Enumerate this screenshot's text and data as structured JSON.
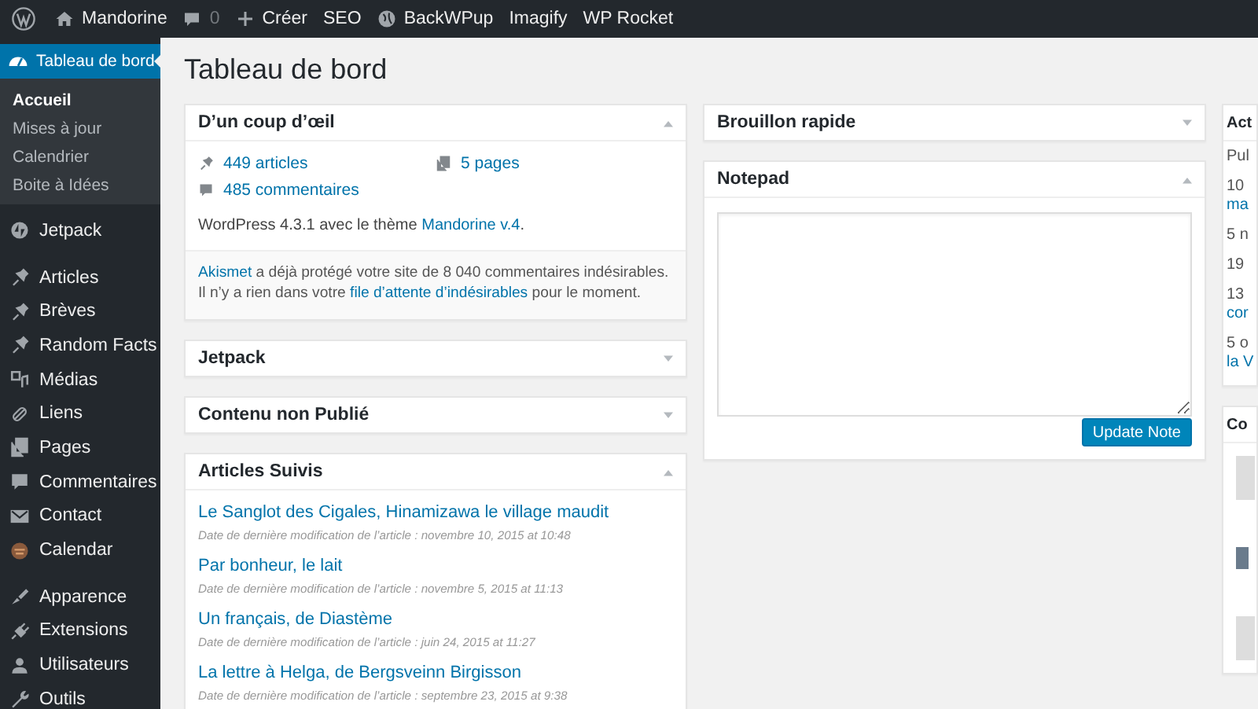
{
  "admin_bar": {
    "site": "Mandorine",
    "comments": "0",
    "items": [
      {
        "label": "Créer"
      },
      {
        "label": "SEO"
      },
      {
        "label": "BackWPup"
      },
      {
        "label": "Imagify"
      },
      {
        "label": "WP Rocket"
      }
    ]
  },
  "sidebar": {
    "current": {
      "label": "Tableau de bord",
      "selected": true,
      "children": [
        {
          "label": "Accueil",
          "selected": true
        },
        {
          "label": "Mises à jour",
          "selected": false
        },
        {
          "label": "Calendrier",
          "selected": false
        },
        {
          "label": "Boite à Idées",
          "selected": false
        }
      ]
    },
    "groups": [
      {
        "items": [
          {
            "label": "Jetpack"
          }
        ]
      },
      {
        "items": [
          {
            "label": "Articles"
          },
          {
            "label": "Brèves"
          },
          {
            "label": "Random Facts"
          },
          {
            "label": "Médias"
          },
          {
            "label": "Liens"
          },
          {
            "label": "Pages"
          },
          {
            "label": "Commentaires"
          },
          {
            "label": "Contact"
          },
          {
            "label": "Calendar"
          }
        ]
      },
      {
        "items": [
          {
            "label": "Apparence"
          },
          {
            "label": "Extensions"
          },
          {
            "label": "Utilisateurs"
          },
          {
            "label": "Outils"
          }
        ]
      }
    ]
  },
  "page_title": "Tableau de bord",
  "glance": {
    "title": "D’un coup d’œil",
    "expanded": true,
    "counts": [
      {
        "label": "449 articles"
      },
      {
        "label": "5 pages"
      },
      {
        "label": "485 commentaires"
      }
    ],
    "version": [
      {
        "text": "WordPress 4.3.1 avec le thème ",
        "link": false
      },
      {
        "text": "Mandorine v.4",
        "link": true
      },
      {
        "text": ".",
        "link": false
      }
    ],
    "akismet": [
      [
        {
          "text": "Akismet",
          "link": true
        },
        {
          "text": " a déjà protégé votre site de 8 040 commentaires indésirables.",
          "link": false
        }
      ],
      [
        {
          "text": "Il n’y a rien dans votre ",
          "link": false
        },
        {
          "text": "file d’attente d’indésirables",
          "link": true
        },
        {
          "text": " pour le moment.",
          "link": false
        }
      ]
    ]
  },
  "collapsed_widgets": [
    {
      "title": "Jetpack",
      "expanded": false
    },
    {
      "title": "Contenu non Publié",
      "expanded": false
    }
  ],
  "followed": {
    "title": "Articles Suivis",
    "expanded": true,
    "items": [
      {
        "title": "Le Sanglot des Cigales, Hinamizawa le village maudit",
        "meta": "Date de dernière modification de l’article : novembre 10, 2015 at 10:48"
      },
      {
        "title": "Par bonheur, le lait",
        "meta": "Date de dernière modification de l’article : novembre 5, 2015 at 11:13"
      },
      {
        "title": "Un français, de Diastème",
        "meta": "Date de dernière modification de l’article : juin 24, 2015 at 11:27"
      },
      {
        "title": "La lettre à Helga, de Bergsveinn Birgisson",
        "meta": "Date de dernière modification de l’article : septembre 23, 2015 at 9:38"
      }
    ]
  },
  "quick_draft": {
    "title": "Brouillon rapide",
    "expanded": false
  },
  "notepad": {
    "title": "Notepad",
    "expanded": true,
    "button": "Update Note"
  },
  "activity": {
    "title": "Act",
    "lines": [
      {
        "text": "Pul",
        "link": false
      },
      {
        "text": "10",
        "link": false
      },
      {
        "text": "ma",
        "link": true
      },
      {
        "text": "5 n",
        "link": false
      },
      {
        "text": "19",
        "link": false
      },
      {
        "text": "13",
        "link": false
      },
      {
        "text": "cor",
        "link": true
      },
      {
        "text": "5 o",
        "link": false
      },
      {
        "text": "la V",
        "link": true
      }
    ]
  },
  "comments_widget": {
    "title": "Co"
  }
}
